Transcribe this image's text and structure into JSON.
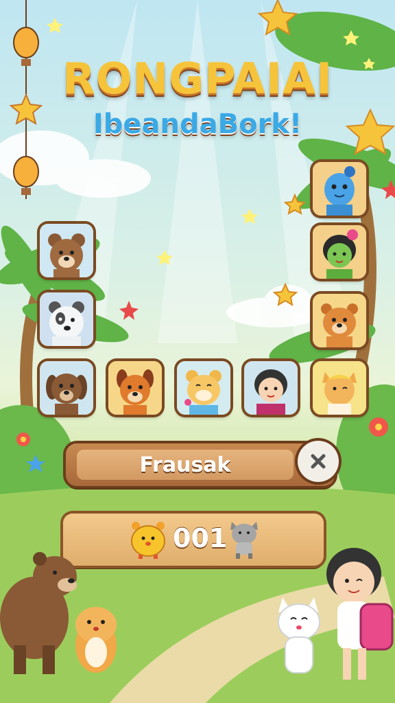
{
  "title": "RONGPAIAI",
  "subtitle": "IbeandaBork!",
  "name_field": {
    "value": "Frausak"
  },
  "counter": {
    "value": "001"
  },
  "avatars": [
    {
      "name": "bear"
    },
    {
      "name": "panda"
    },
    {
      "name": "puppy"
    },
    {
      "name": "fox"
    },
    {
      "name": "hamster-girl"
    },
    {
      "name": "girl"
    },
    {
      "name": "cat-boy"
    },
    {
      "name": "blue-monster"
    },
    {
      "name": "green-girl"
    },
    {
      "name": "lion"
    }
  ],
  "colors": {
    "accent": "#f6c43b",
    "wood": "#a8683a",
    "sky": "#bfe6f2"
  }
}
